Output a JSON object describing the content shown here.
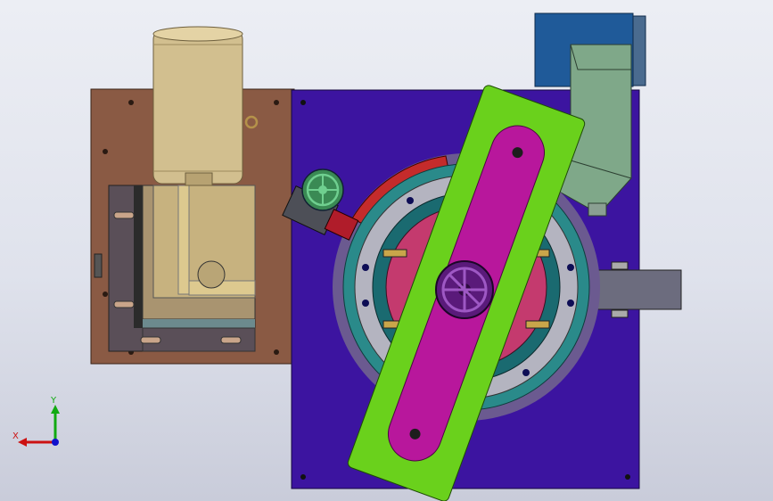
{
  "triad": {
    "x_label": "X",
    "y_label": "Y",
    "x_color": "#cc1111",
    "y_color": "#11aa11",
    "z_color": "#1111cc"
  },
  "colors": {
    "background_top": "#eceef4",
    "background_bottom": "#c9ccda",
    "main_plate": "#3c14a0",
    "side_plate": "#8a5a44",
    "motor": "#d2bf8f",
    "lever_arm": "#6ad11c",
    "lever_slot": "#b8179c",
    "rotary_ring": "#b4b4c0",
    "rotary_inner": "#c43a6e",
    "hopper": "#7fa889",
    "hopper_box": "#1f5a99",
    "chute": "#6c6c7e",
    "handwheel": "#6fcf8f"
  },
  "parts": [
    {
      "name": "motor-cylinder",
      "icon": "cylinder"
    },
    {
      "name": "gearbox",
      "icon": "box"
    },
    {
      "name": "rotary-table",
      "icon": "disc"
    },
    {
      "name": "lever-arm",
      "icon": "bar"
    },
    {
      "name": "handwheel-center",
      "icon": "wheel"
    },
    {
      "name": "handwheel-small",
      "icon": "wheel"
    },
    {
      "name": "feed-hopper",
      "icon": "hopper"
    },
    {
      "name": "output-chute",
      "icon": "chute"
    }
  ]
}
